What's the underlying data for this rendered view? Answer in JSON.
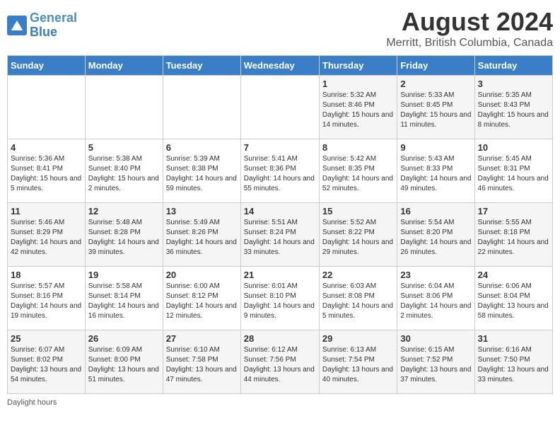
{
  "header": {
    "logo_line1": "General",
    "logo_line2": "Blue",
    "title": "August 2024",
    "subtitle": "Merritt, British Columbia, Canada"
  },
  "days_of_week": [
    "Sunday",
    "Monday",
    "Tuesday",
    "Wednesday",
    "Thursday",
    "Friday",
    "Saturday"
  ],
  "footer": {
    "note": "Daylight hours"
  },
  "weeks": [
    [
      {
        "day": "",
        "sunrise": "",
        "sunset": "",
        "daylight": ""
      },
      {
        "day": "",
        "sunrise": "",
        "sunset": "",
        "daylight": ""
      },
      {
        "day": "",
        "sunrise": "",
        "sunset": "",
        "daylight": ""
      },
      {
        "day": "",
        "sunrise": "",
        "sunset": "",
        "daylight": ""
      },
      {
        "day": "1",
        "sunrise": "Sunrise: 5:32 AM",
        "sunset": "Sunset: 8:46 PM",
        "daylight": "Daylight: 15 hours and 14 minutes."
      },
      {
        "day": "2",
        "sunrise": "Sunrise: 5:33 AM",
        "sunset": "Sunset: 8:45 PM",
        "daylight": "Daylight: 15 hours and 11 minutes."
      },
      {
        "day": "3",
        "sunrise": "Sunrise: 5:35 AM",
        "sunset": "Sunset: 8:43 PM",
        "daylight": "Daylight: 15 hours and 8 minutes."
      }
    ],
    [
      {
        "day": "4",
        "sunrise": "Sunrise: 5:36 AM",
        "sunset": "Sunset: 8:41 PM",
        "daylight": "Daylight: 15 hours and 5 minutes."
      },
      {
        "day": "5",
        "sunrise": "Sunrise: 5:38 AM",
        "sunset": "Sunset: 8:40 PM",
        "daylight": "Daylight: 15 hours and 2 minutes."
      },
      {
        "day": "6",
        "sunrise": "Sunrise: 5:39 AM",
        "sunset": "Sunset: 8:38 PM",
        "daylight": "Daylight: 14 hours and 59 minutes."
      },
      {
        "day": "7",
        "sunrise": "Sunrise: 5:41 AM",
        "sunset": "Sunset: 8:36 PM",
        "daylight": "Daylight: 14 hours and 55 minutes."
      },
      {
        "day": "8",
        "sunrise": "Sunrise: 5:42 AM",
        "sunset": "Sunset: 8:35 PM",
        "daylight": "Daylight: 14 hours and 52 minutes."
      },
      {
        "day": "9",
        "sunrise": "Sunrise: 5:43 AM",
        "sunset": "Sunset: 8:33 PM",
        "daylight": "Daylight: 14 hours and 49 minutes."
      },
      {
        "day": "10",
        "sunrise": "Sunrise: 5:45 AM",
        "sunset": "Sunset: 8:31 PM",
        "daylight": "Daylight: 14 hours and 46 minutes."
      }
    ],
    [
      {
        "day": "11",
        "sunrise": "Sunrise: 5:46 AM",
        "sunset": "Sunset: 8:29 PM",
        "daylight": "Daylight: 14 hours and 42 minutes."
      },
      {
        "day": "12",
        "sunrise": "Sunrise: 5:48 AM",
        "sunset": "Sunset: 8:28 PM",
        "daylight": "Daylight: 14 hours and 39 minutes."
      },
      {
        "day": "13",
        "sunrise": "Sunrise: 5:49 AM",
        "sunset": "Sunset: 8:26 PM",
        "daylight": "Daylight: 14 hours and 36 minutes."
      },
      {
        "day": "14",
        "sunrise": "Sunrise: 5:51 AM",
        "sunset": "Sunset: 8:24 PM",
        "daylight": "Daylight: 14 hours and 33 minutes."
      },
      {
        "day": "15",
        "sunrise": "Sunrise: 5:52 AM",
        "sunset": "Sunset: 8:22 PM",
        "daylight": "Daylight: 14 hours and 29 minutes."
      },
      {
        "day": "16",
        "sunrise": "Sunrise: 5:54 AM",
        "sunset": "Sunset: 8:20 PM",
        "daylight": "Daylight: 14 hours and 26 minutes."
      },
      {
        "day": "17",
        "sunrise": "Sunrise: 5:55 AM",
        "sunset": "Sunset: 8:18 PM",
        "daylight": "Daylight: 14 hours and 22 minutes."
      }
    ],
    [
      {
        "day": "18",
        "sunrise": "Sunrise: 5:57 AM",
        "sunset": "Sunset: 8:16 PM",
        "daylight": "Daylight: 14 hours and 19 minutes."
      },
      {
        "day": "19",
        "sunrise": "Sunrise: 5:58 AM",
        "sunset": "Sunset: 8:14 PM",
        "daylight": "Daylight: 14 hours and 16 minutes."
      },
      {
        "day": "20",
        "sunrise": "Sunrise: 6:00 AM",
        "sunset": "Sunset: 8:12 PM",
        "daylight": "Daylight: 14 hours and 12 minutes."
      },
      {
        "day": "21",
        "sunrise": "Sunrise: 6:01 AM",
        "sunset": "Sunset: 8:10 PM",
        "daylight": "Daylight: 14 hours and 9 minutes."
      },
      {
        "day": "22",
        "sunrise": "Sunrise: 6:03 AM",
        "sunset": "Sunset: 8:08 PM",
        "daylight": "Daylight: 14 hours and 5 minutes."
      },
      {
        "day": "23",
        "sunrise": "Sunrise: 6:04 AM",
        "sunset": "Sunset: 8:06 PM",
        "daylight": "Daylight: 14 hours and 2 minutes."
      },
      {
        "day": "24",
        "sunrise": "Sunrise: 6:06 AM",
        "sunset": "Sunset: 8:04 PM",
        "daylight": "Daylight: 13 hours and 58 minutes."
      }
    ],
    [
      {
        "day": "25",
        "sunrise": "Sunrise: 6:07 AM",
        "sunset": "Sunset: 8:02 PM",
        "daylight": "Daylight: 13 hours and 54 minutes."
      },
      {
        "day": "26",
        "sunrise": "Sunrise: 6:09 AM",
        "sunset": "Sunset: 8:00 PM",
        "daylight": "Daylight: 13 hours and 51 minutes."
      },
      {
        "day": "27",
        "sunrise": "Sunrise: 6:10 AM",
        "sunset": "Sunset: 7:58 PM",
        "daylight": "Daylight: 13 hours and 47 minutes."
      },
      {
        "day": "28",
        "sunrise": "Sunrise: 6:12 AM",
        "sunset": "Sunset: 7:56 PM",
        "daylight": "Daylight: 13 hours and 44 minutes."
      },
      {
        "day": "29",
        "sunrise": "Sunrise: 6:13 AM",
        "sunset": "Sunset: 7:54 PM",
        "daylight": "Daylight: 13 hours and 40 minutes."
      },
      {
        "day": "30",
        "sunrise": "Sunrise: 6:15 AM",
        "sunset": "Sunset: 7:52 PM",
        "daylight": "Daylight: 13 hours and 37 minutes."
      },
      {
        "day": "31",
        "sunrise": "Sunrise: 6:16 AM",
        "sunset": "Sunset: 7:50 PM",
        "daylight": "Daylight: 13 hours and 33 minutes."
      }
    ]
  ]
}
